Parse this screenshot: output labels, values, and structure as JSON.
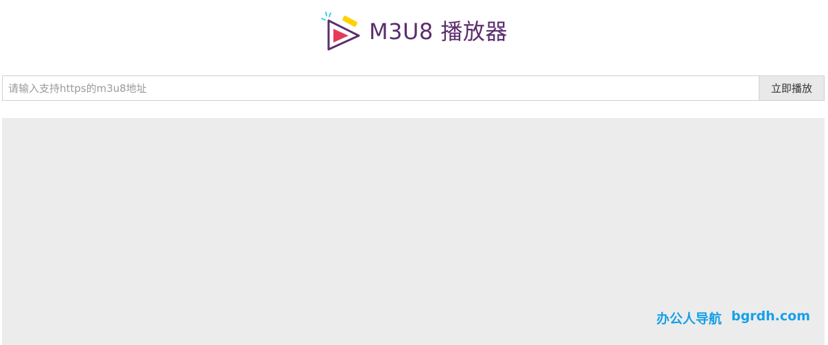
{
  "header": {
    "title": "M3U8 播放器",
    "logo_icon": "play-triangle-icon",
    "colors": {
      "title": "#5b2d6e",
      "triangle_outline": "#5b2d6e",
      "play_fill": "#e8385a",
      "yellow_accent": "#ffd200",
      "cyan_accent": "#31d3e6"
    }
  },
  "search": {
    "placeholder": "请输入支持https的m3u8地址",
    "value": "",
    "button_label": "立即播放"
  },
  "player": {
    "background": "#ececec",
    "watermark": {
      "cn": "办公人导航",
      "domain": "bgrdh.com",
      "color": "#16a0e8"
    }
  }
}
